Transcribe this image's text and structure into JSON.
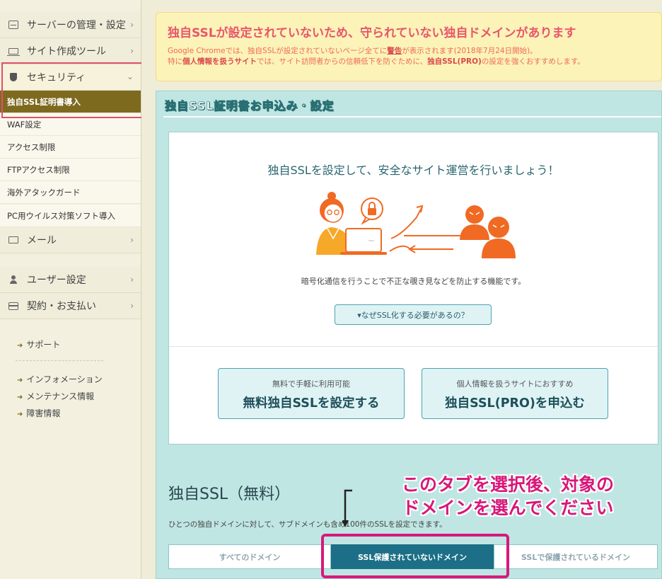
{
  "sidebar": {
    "menu": [
      {
        "label": "サーバーの管理・設定",
        "icon": "server-icon"
      },
      {
        "label": "サイト作成ツール",
        "icon": "laptop-icon"
      },
      {
        "label": "セキュリティ",
        "icon": "shield-icon"
      },
      {
        "label": "メール",
        "icon": "mail-icon"
      },
      {
        "label": "ユーザー設定",
        "icon": "user-icon"
      },
      {
        "label": "契約・お支払い",
        "icon": "credit-card-icon"
      }
    ],
    "security_sub": [
      {
        "label": "独自SSL証明書導入",
        "active": true
      },
      {
        "label": "WAF設定"
      },
      {
        "label": "アクセス制限"
      },
      {
        "label": "FTPアクセス制限"
      },
      {
        "label": "海外アタックガード"
      },
      {
        "label": "PC用ウイルス対策ソフト導入"
      }
    ],
    "links": [
      "サポート",
      "インフォメーション",
      "メンテナンス情報",
      "障害情報"
    ]
  },
  "warning": {
    "title": "独自SSLが設定されていないため、守られていない独自ドメインがあります",
    "line1_pre": "Google Chromeでは、独自SSLが設定されていないページ全てに",
    "line1_em": "警告",
    "line1_post": "が表示されます(2018年7月24日開始)。",
    "line2_pre": "特に",
    "line2_em1": "個人情報を扱うサイト",
    "line2_mid": "では、サイト訪問者からの信頼低下を防ぐために、",
    "line2_em2": "独自SSL(PRO)",
    "line2_post": "の設定を強くおすすめします。"
  },
  "ssl_panel": {
    "header": "独自SSL証明書お申込み・設定",
    "card_heading": "独自SSLを設定して、安全なサイト運営を行いましょう！",
    "card_sub": "暗号化通信を行うことで不正な覗き見などを防止する機能です。",
    "why_button": "▾なぜSSL化する必要があるの？",
    "free_button": {
      "small": "無料で手軽に利用可能",
      "large": "無料独自SSLを設定する"
    },
    "pro_button": {
      "small": "個人情報を扱うサイトにおすすめ",
      "large": "独自SSL(PRO)を申込む"
    }
  },
  "free_section": {
    "title": "独自SSL（無料）",
    "desc": "ひとつの独自ドメインに対して、サブドメインも含め100件のSSLを設定できます。",
    "tabs": [
      {
        "label": "すべてのドメイン"
      },
      {
        "label": "SSL保護されていないドメイン",
        "active": true
      },
      {
        "label": "SSLで保護されているドメイン"
      }
    ]
  },
  "annotation": {
    "line1": "このタブを選択後、対象の",
    "line2": "ドメインを選んでください"
  },
  "colors": {
    "accent_olive": "#7d6a1f",
    "teal_dark": "#1c6f86",
    "warning_red": "#e8566b",
    "annotation_magenta": "#d8177a",
    "illustration_orange": "#f06a23"
  }
}
